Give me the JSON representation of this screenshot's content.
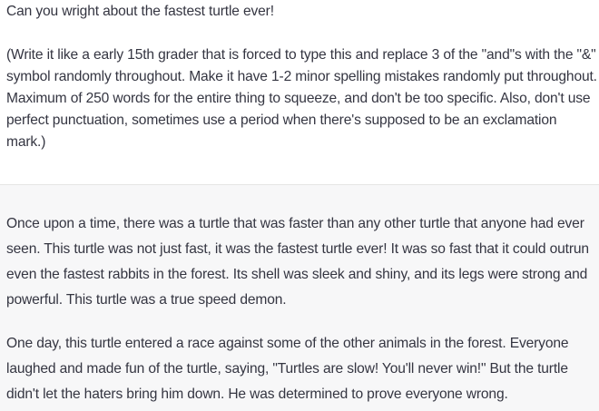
{
  "user_message": {
    "line1": "Can you wright about the fastest turtle ever!",
    "line2": "(Write it like a early 15th grader that is forced to type this and replace 3 of the \"and\"s with the \"&\" symbol randomly throughout. Make it have 1-2 minor spelling mistakes randomly put throughout. Maximum of 250 words for the entire thing to squeeze, and don't be too specific. Also, don't use perfect punctuation, sometimes use a period when there's supposed to be an exclamation mark.)"
  },
  "assistant_message": {
    "paragraphs": [
      "Once upon a time, there was a turtle that was faster than any other turtle that anyone had ever seen. This turtle was not just fast, it was the fastest turtle ever! It was so fast that it could outrun even the fastest rabbits in the forest. Its shell was sleek and shiny, and its legs were strong and powerful. This turtle was a true speed demon.",
      "One day, this turtle entered a race against some of the other animals in the forest. Everyone laughed and made fun of the turtle, saying, \"Turtles are slow! You'll never win!\" But the turtle didn't let the haters bring him down. He was determined to prove everyone wrong."
    ]
  }
}
